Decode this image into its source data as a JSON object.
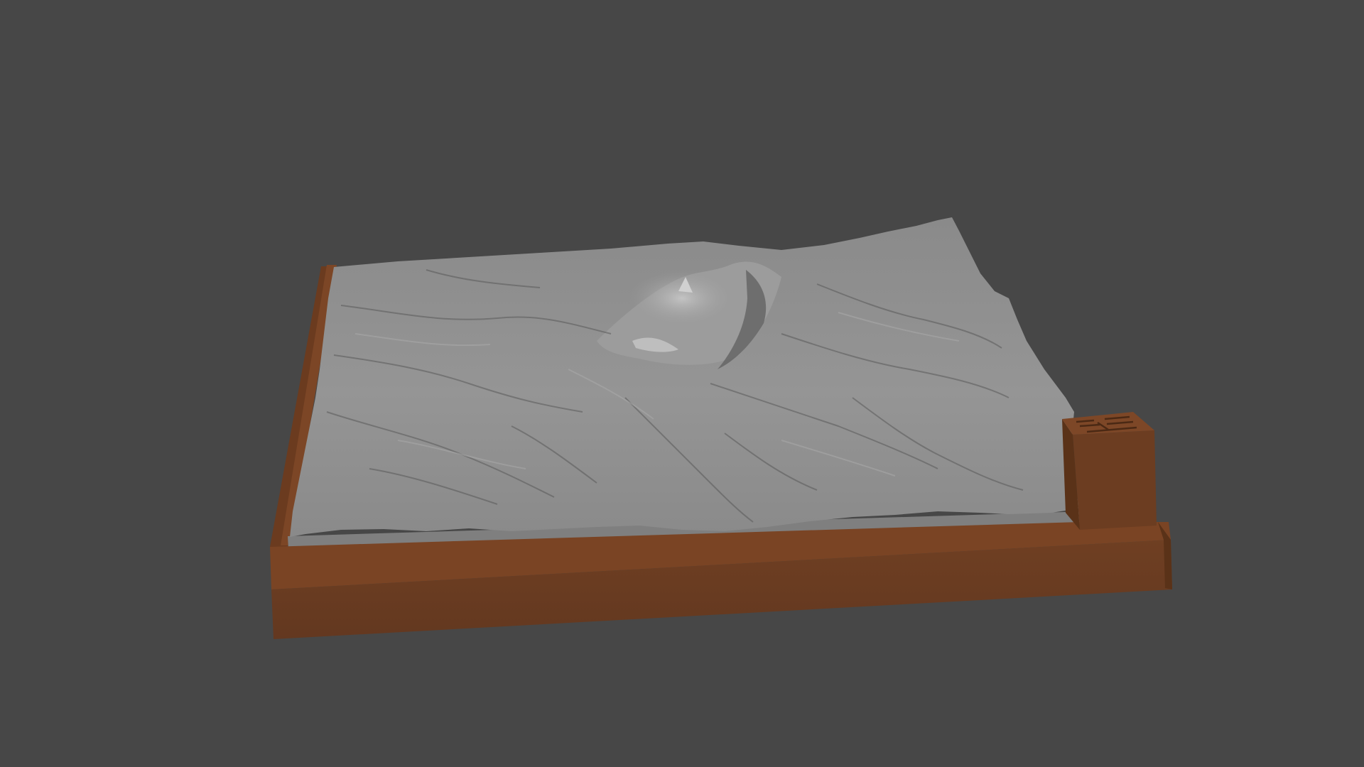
{
  "viewport": {
    "background_color": "#474747",
    "object": "terrain-relief-model",
    "colors": {
      "terrain": "#8e8e8e",
      "terrain_highlight": "#b4b4b4",
      "terrain_shadow": "#4f4f4f",
      "base_wood_top": "#7a4424",
      "base_wood_front": "#6a3c20",
      "base_wood_side": "#5a3218",
      "inner_floor": "#7f7f7f"
    }
  }
}
